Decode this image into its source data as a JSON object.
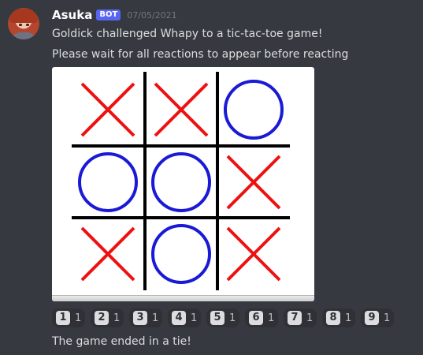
{
  "message": {
    "author": "Asuka",
    "bot_tag": "BOT",
    "timestamp": "07/05/2021",
    "lines": [
      "Goldick challenged Whapy to a tic-tac-toe game!",
      "Please wait for all reactions to appear before reacting"
    ],
    "result": "The game ended in a tie!"
  },
  "board": {
    "cells": [
      "X",
      "X",
      "O",
      "O",
      "O",
      "X",
      "X",
      "O",
      "X"
    ],
    "colors": {
      "x": "#ee1111",
      "o": "#1a1ad6",
      "grid": "#000000"
    }
  },
  "reactions": [
    {
      "emoji": "1",
      "count": "1"
    },
    {
      "emoji": "2",
      "count": "1"
    },
    {
      "emoji": "3",
      "count": "1"
    },
    {
      "emoji": "4",
      "count": "1"
    },
    {
      "emoji": "5",
      "count": "1"
    },
    {
      "emoji": "6",
      "count": "1"
    },
    {
      "emoji": "7",
      "count": "1"
    },
    {
      "emoji": "8",
      "count": "1"
    },
    {
      "emoji": "9",
      "count": "1"
    }
  ],
  "colors": {
    "background": "#36393f",
    "text": "#dcddde",
    "bot_tag": "#5865f2",
    "reaction_bg": "#2f3136"
  }
}
